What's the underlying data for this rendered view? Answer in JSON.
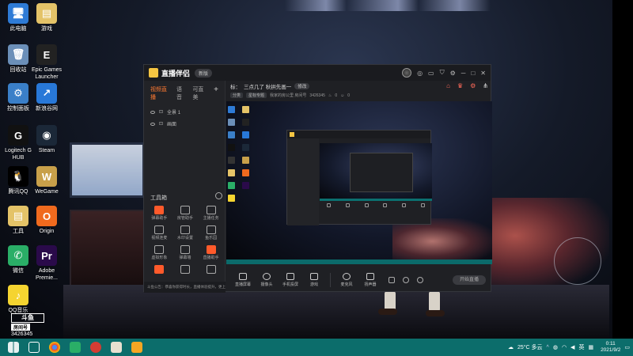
{
  "desktop": {
    "icons": [
      {
        "name": "此电脑",
        "color": "#2e7bd6",
        "glyph": "🖥"
      },
      {
        "name": "游戏",
        "color": "#e4c368",
        "glyph": "▤"
      },
      {
        "name": "回收站",
        "color": "#6b8fb8",
        "glyph": "🗑"
      },
      {
        "name": "Epic Games Launcher",
        "color": "#222222",
        "glyph": "E"
      },
      {
        "name": "控制面板",
        "color": "#3a7fc8",
        "glyph": "⚙"
      },
      {
        "name": "新浪谷网",
        "color": "#2878d8",
        "glyph": "↗"
      },
      {
        "name": "Logitech G HUB",
        "color": "#111111",
        "glyph": "G"
      },
      {
        "name": "Steam",
        "color": "#1b2838",
        "glyph": "◉"
      },
      {
        "name": "腾讯QQ",
        "color": "#000000",
        "glyph": "🐧"
      },
      {
        "name": "WeGame",
        "color": "#c8a04a",
        "glyph": "W"
      },
      {
        "name": "工具",
        "color": "#e4c368",
        "glyph": "▤"
      },
      {
        "name": "Origin",
        "color": "#f06a1e",
        "glyph": "O"
      },
      {
        "name": "微信",
        "color": "#2aae67",
        "glyph": "✆"
      },
      {
        "name": "Adobe Premie...",
        "color": "#2a0a4a",
        "glyph": "Pr"
      },
      {
        "name": "QQ音乐",
        "color": "#f5d430",
        "glyph": "♪"
      }
    ]
  },
  "app": {
    "title": "直播伴侣",
    "version_pill": "新版",
    "top_icons": [
      "headset-icon",
      "message-icon",
      "shirt-icon",
      "settings-icon",
      "minimize-icon",
      "maximize-icon",
      "close-icon"
    ],
    "tabs": {
      "active": "视频直播",
      "items": [
        "视频直播",
        "语音",
        "可直美"
      ],
      "add": "+"
    },
    "scenes": [
      {
        "label": "全景 1"
      },
      {
        "label": "画面"
      }
    ],
    "tools_title": "工具箱",
    "tools": [
      {
        "label": "弹幕助手",
        "hot": true
      },
      {
        "label": "房管助手",
        "hot": false
      },
      {
        "label": "主播任务",
        "hot": false
      },
      {
        "label": "视频连麦",
        "hot": false
      },
      {
        "label": "水印设置",
        "hot": false
      },
      {
        "label": "鱼乐园",
        "hot": false
      },
      {
        "label": "虚拟形象",
        "hot": false
      },
      {
        "label": "弹幕墙",
        "hot": false
      },
      {
        "label": "直播助手",
        "hot": true
      },
      {
        "label": "",
        "hot": true
      },
      {
        "label": "",
        "hot": false
      },
      {
        "label": "",
        "hot": false
      }
    ],
    "notice": "斗鱼公告：恭喜你获得时长，直播体验提升，更上一层楼",
    "room": {
      "title_prefix": "标：",
      "title": "三点几了 秋拱先画一",
      "edit_tag": "修改",
      "ctrl_icons": [
        "gift-icon",
        "share-icon",
        "settings-icon"
      ],
      "info_tag1": "分类",
      "info_tag2": "星标专题",
      "info_text": "我家的房公里 房间号",
      "room_id": "3426345",
      "likes": "0",
      "viewers": "0"
    },
    "bottom_controls": [
      {
        "label": "直播屏幕",
        "icon": "screen-icon"
      },
      {
        "label": "摄像头",
        "icon": "camera-icon"
      },
      {
        "label": "手机投屏",
        "icon": "phone-icon"
      },
      {
        "label": "游戏",
        "icon": "game-icon"
      },
      {
        "label": "麦克风",
        "icon": "mic-icon"
      },
      {
        "label": "扬声器",
        "icon": "speaker-icon"
      }
    ],
    "go_live": "开始直播"
  },
  "watermark": {
    "logo": "斗鱼",
    "tag": "房间号",
    "number": "3426345"
  },
  "taskbar": {
    "weather": "25°C 多云",
    "ime": "英",
    "time": "0:11",
    "date": "2021/9/2"
  }
}
